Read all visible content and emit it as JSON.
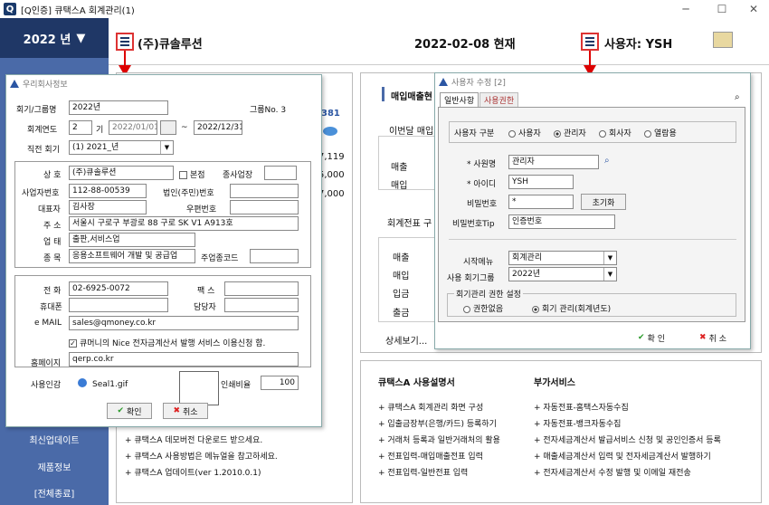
{
  "app": {
    "title": "[Q인증] 큐택스A  회계관리(1)",
    "logo": "Q",
    "minimize": "─",
    "maximize": "☐",
    "close": "✕"
  },
  "sidebar": {
    "year": "2022 년",
    "links": [
      "최신업데이트",
      "제품정보",
      "[전체종료]"
    ]
  },
  "header": {
    "company": "(주)큐솔루션",
    "date": "2022-02-08 현재",
    "user": "사용자: YSH"
  },
  "company_dialog": {
    "title": "우리회사정보",
    "fields": {
      "period_label": "회기/그룹명",
      "period_value": "2022년",
      "group_no": "그룹No. 3",
      "fiscal_label": "회계연도",
      "fiscal_no": "2",
      "fiscal_unit": "기",
      "fiscal_start": "2022/01/01",
      "fiscal_end": "2022/12/31",
      "prev_label": "직전 회기",
      "prev_value": "(1) 2021_년",
      "name_label": "상 호",
      "name_value": "(주)큐솔루션",
      "hq_label": "본점",
      "biz_place_label": "종사업장",
      "bizno_label": "사업자번호",
      "bizno_value": "112-88-00539",
      "corpno_label": "법인(주민)번호",
      "ceo_label": "대표자",
      "ceo_value": "김사장",
      "zip_label": "우편번호",
      "addr_label": "주 소",
      "addr_value": "서울시 구로구 부광로 88 구로 SK V1 A913호",
      "biztype_label": "업 태",
      "biztype_value": "출판,서비스업",
      "item_label": "종 목",
      "item_value": "응용소프트웨어 개발 및 공급업",
      "mainitem_label": "주업종코드",
      "tel_label": "전 화",
      "tel_value": "02-6925-0072",
      "fax_label": "팩 스",
      "mobile_label": "휴대폰",
      "manager_label": "담당자",
      "email_label": "e MAIL",
      "email_value": "sales@qmoney.co.kr",
      "nice_label": "큐머니의 Nice 전자금계산서 발행 서비스 이용신청 함.",
      "home_label": "홈페이지",
      "home_value": "qerp.co.kr",
      "seal_label": "사용인감",
      "seal_value": "Seal1.gif",
      "ratio_label": "인쇄비율",
      "ratio_value": "100",
      "ok": "확인",
      "cancel": "취소"
    }
  },
  "user_dialog": {
    "title": "사용자 수정 [2]",
    "tabs": [
      "일반사항",
      "사용권한"
    ],
    "type_label": "사용자 구분",
    "types": [
      "사용자",
      "관리자",
      "회사자",
      "열람용"
    ],
    "selected_type": "관리자",
    "empname_label": "* 사원명",
    "empname_value": "관리자",
    "id_label": "* 아이디",
    "id_value": "YSH",
    "pw_label": "비밀번호",
    "pw_value": "*",
    "reset": "초기화",
    "tip_label": "비밀번호Tip",
    "tip_value": "인증번호",
    "menu_label": "시작메뉴",
    "menu_value": "회계관리",
    "group_label": "사용 회기그룹",
    "group_value": "2022년",
    "perm_title": "회기관리 권한 설정",
    "perm_none": "권한없음",
    "perm_manage": "회기 관리(회계년도)",
    "ok": "확 인",
    "cancel": "취 소"
  },
  "bg": {
    "sales_title": "매입매출현",
    "prev_month": "이번달 매입",
    "rows": [
      "매출",
      "매입"
    ],
    "nums": [
      "381",
      "7,119",
      "5,000",
      "7,000"
    ],
    "journal": "회계전표 구",
    "rows2": [
      "매출",
      "매입",
      "입금",
      "출금"
    ],
    "more": "상세보기...",
    "manual_title": "큐택스A 사용설명서",
    "manual_items": [
      "큐택스A 회계관리 화면 구성",
      "입출금장부(은행/카드) 등록하기",
      "거래처 등록과 일반거래처의 활용",
      "전표입력-매입매출전표 입력",
      "전표입력-일반전표 입력"
    ],
    "extra_title": "부가서비스",
    "extra_items": [
      "자동전표-홈택스자동수집",
      "자동전표-뱅크자동수집",
      "전자세금계산서 발급서비스 신청 및 공인인증서 등록",
      "매출세금계산서 입력 및 전자세금계산서 발행하기",
      "전자세금계산서 수정 발행 및 이메일 재전송"
    ],
    "news": [
      "큐택스A 데모버전 다운로드 받으세요.",
      "큐택스A 사용방법은 메뉴얼을 참고하세요.",
      "큐택스A 업데이트(ver 1.2010.0.1)"
    ]
  }
}
